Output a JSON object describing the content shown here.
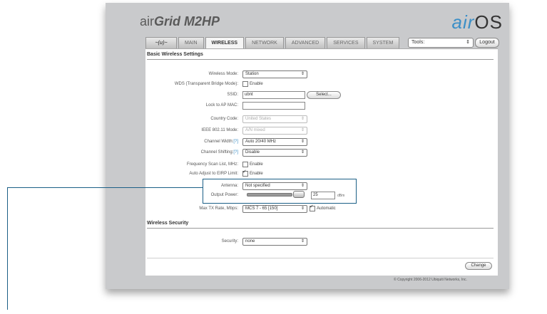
{
  "brand": {
    "product_prefix": "air",
    "product_name": "Grid ",
    "model": "M2HP",
    "os_prefix": "air",
    "os_name": "OS"
  },
  "tabs": [
    {
      "label": "~(u)~",
      "active": false
    },
    {
      "label": "MAIN",
      "active": false
    },
    {
      "label": "WIRELESS",
      "active": true
    },
    {
      "label": "NETWORK",
      "active": false
    },
    {
      "label": "ADVANCED",
      "active": false
    },
    {
      "label": "SERVICES",
      "active": false
    },
    {
      "label": "SYSTEM",
      "active": false
    }
  ],
  "header": {
    "tools_label": "Tools:",
    "logout_label": "Logout"
  },
  "basic": {
    "title": "Basic Wireless Settings",
    "wireless_mode": {
      "label": "Wireless Mode:",
      "value": "Station"
    },
    "wds": {
      "label": "WDS (Transparent Bridge Mode):",
      "option": "Enable",
      "checked": false
    },
    "ssid": {
      "label": "SSID:",
      "value": "ubnt",
      "select_label": "Select..."
    },
    "lock_ap": {
      "label": "Lock to AP MAC:",
      "value": ""
    },
    "country": {
      "label": "Country Code:",
      "value": "United States"
    },
    "ieee_mode": {
      "label": "IEEE 802.11 Mode:",
      "value": "A/N mixed"
    },
    "channel_width": {
      "label": "Channel Width:",
      "help": "[?]",
      "value": "Auto 20/40 MHz"
    },
    "channel_shifting": {
      "label": "Channel Shifting:",
      "help": "[?]",
      "value": "Disable"
    },
    "freq_scan": {
      "label": "Frequency Scan List, MHz:",
      "option": "Enable",
      "checked": false
    },
    "auto_adjust": {
      "label": "Auto Adjust to EIRP Limit:",
      "option": "Enable",
      "checked": true
    },
    "antenna": {
      "label": "Antenna:",
      "value": "Not specified"
    },
    "output_power": {
      "label": "Output Power:",
      "value": "25",
      "unit": "dBm",
      "slider_level": 0.93
    },
    "max_tx_rate": {
      "label": "Max TX Rate, Mbps:",
      "value": "MCS 7 - 65 [150]",
      "auto_label": "Automatic",
      "auto_checked": true
    }
  },
  "security": {
    "title": "Wireless Security",
    "label": "Security:",
    "value": "none"
  },
  "footer": {
    "change_label": "Change",
    "copyright": "© Copyright 2006-2012 Ubiquiti Networks, Inc."
  },
  "colors": {
    "accent_blue": "#3b8fc7",
    "callout_line": "#1b5f86"
  }
}
